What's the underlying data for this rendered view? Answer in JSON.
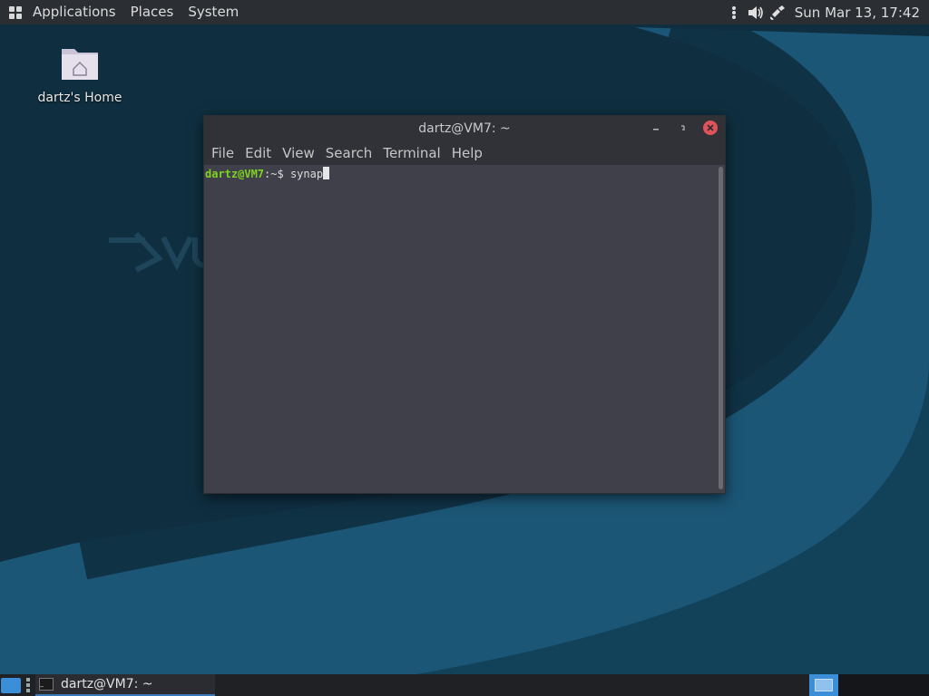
{
  "top_panel": {
    "menu": [
      "Applications",
      "Places",
      "System"
    ],
    "clock": "Sun Mar 13, 17:42",
    "tray_icons": [
      "more-vertical-icon",
      "volume-icon",
      "network-icon"
    ]
  },
  "desktop": {
    "home_label": "dartz's Home"
  },
  "terminal": {
    "title": "dartz@VM7: ~",
    "menu": [
      "File",
      "Edit",
      "View",
      "Search",
      "Terminal",
      "Help"
    ],
    "prompt_user": "dartz@VM7",
    "prompt_path": ":~$ ",
    "command": "synap"
  },
  "taskbar": {
    "task_label": "dartz@VM7: ~"
  },
  "colors": {
    "prompt": "#7ed321",
    "accent": "#3b8fd8",
    "close_button": "#e0535a"
  }
}
